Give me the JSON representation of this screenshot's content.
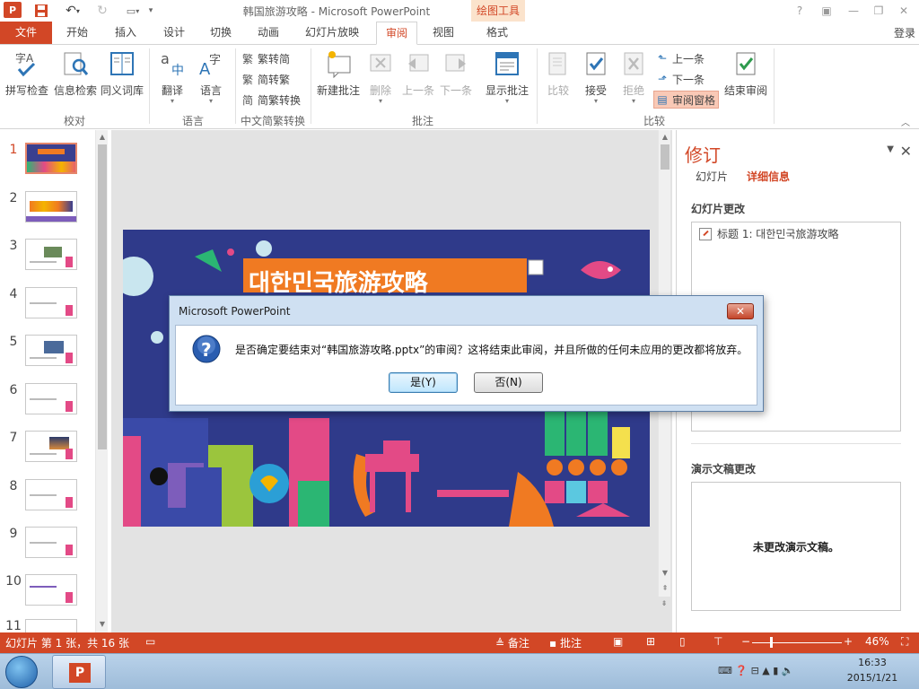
{
  "app": {
    "document_title": "韩国旅游攻略 - Microsoft PowerPoint",
    "context_tab_group": "绘图工具",
    "login": "登录",
    "window_buttons": [
      "?",
      "□",
      "—",
      "❐",
      "✕"
    ]
  },
  "tabs": [
    {
      "label": "文件"
    },
    {
      "label": "开始"
    },
    {
      "label": "插入"
    },
    {
      "label": "设计"
    },
    {
      "label": "切换"
    },
    {
      "label": "动画"
    },
    {
      "label": "幻灯片放映"
    },
    {
      "label": "审阅"
    },
    {
      "label": "视图"
    },
    {
      "label": "格式"
    }
  ],
  "active_tab": "审阅",
  "ribbon": {
    "proofing": {
      "group": "校对",
      "spell": "拼写检查",
      "research": "信息检索",
      "thesaurus": "同义词库"
    },
    "language": {
      "group": "语言",
      "translate": "翻译",
      "language": "语言"
    },
    "chinese": {
      "group": "中文简繁转换",
      "to_simplified": "繁转简",
      "to_traditional": "简转繁",
      "convert": "简繁转换"
    },
    "comments": {
      "group": "批注",
      "new": "新建批注",
      "delete": "删除",
      "prev": "上一条",
      "next": "下一条",
      "show": "显示批注"
    },
    "compare": {
      "group": "比较",
      "compare": "比较",
      "accept": "接受",
      "reject": "拒绝",
      "prev": "上一条",
      "next": "下一条",
      "pane": "审阅窗格",
      "end": "结束审阅"
    }
  },
  "thumbnails": {
    "selected": 1,
    "numbers": [
      "1",
      "2",
      "3",
      "4",
      "5",
      "6",
      "7",
      "8",
      "9",
      "10",
      "11"
    ]
  },
  "slide": {
    "title_text": "대한민국旅游攻略"
  },
  "revision_pane": {
    "title": "修订",
    "tab_slides": "幻灯片",
    "tab_details": "详细信息",
    "slide_changes_label": "幻灯片更改",
    "slide_change_item": "标题 1: 대한민국旅游攻略",
    "presentation_changes_label": "演示文稿更改",
    "no_changes_text": "未更改演示文稿。"
  },
  "dialog": {
    "title": "Microsoft PowerPoint",
    "message": "是否确定要结束对“韩国旅游攻略.pptx”的审阅？这将结束此审阅，并且所做的任何未应用的更改都将放弃。",
    "yes": "是(Y)",
    "no": "否(N)"
  },
  "statusbar": {
    "slide_info": "幻灯片 第 1 张，共 16 张",
    "notes": "备注",
    "comments": "批注",
    "zoom": "46%"
  },
  "taskbar": {
    "time": "16:33",
    "date": "2015/1/21"
  },
  "colors": {
    "accent": "#d24726",
    "slide_bg": "#2f3a8a",
    "title_box": "#f07a22"
  }
}
